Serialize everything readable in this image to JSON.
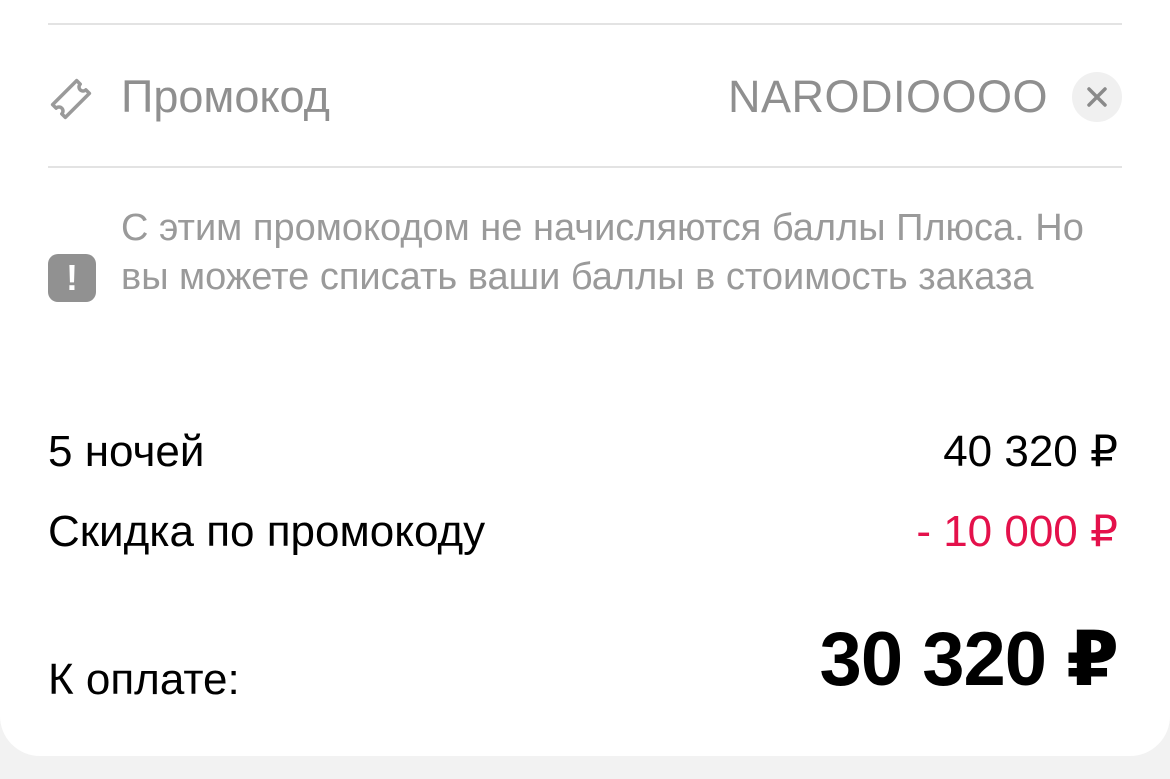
{
  "promo": {
    "label": "Промокод",
    "code": "NARODIOOOO",
    "icon": "ticket-icon",
    "clear_icon": "close-icon"
  },
  "notice": {
    "icon": "exclamation-icon",
    "text": "С этим промокодом не начисляются баллы Плюса. Но вы можете списать ваши баллы в стоимость заказа"
  },
  "summary": {
    "nights_label": "5 ночей",
    "nights_price": "40 320 ₽",
    "discount_label": "Скидка по промокоду",
    "discount_value": "- 10 000 ₽",
    "total_label": "К оплате:",
    "total_value": "30 320 ₽"
  },
  "colors": {
    "muted_text": "#8f8f8f",
    "discount": "#e4114b",
    "divider": "#e3e3e3"
  }
}
